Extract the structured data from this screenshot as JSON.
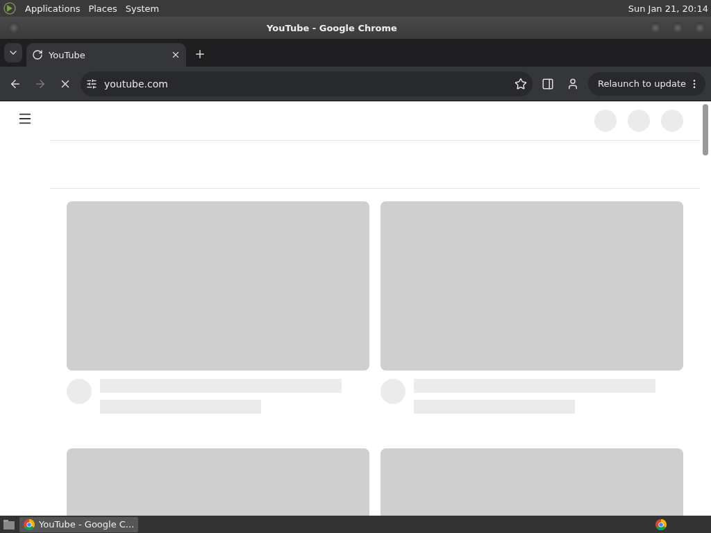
{
  "top_panel": {
    "menus": [
      "Applications",
      "Places",
      "System"
    ],
    "clock": "Sun Jan 21, 20:14"
  },
  "window": {
    "title": "YouTube - Google Chrome"
  },
  "tabs": [
    {
      "label": "YouTube",
      "selected": true
    }
  ],
  "toolbar": {
    "address": "youtube.com",
    "loading": true,
    "relaunch": "Relaunch to update"
  },
  "taskbar": {
    "items": [
      {
        "label": "YouTube - Google C...",
        "selected": true
      }
    ]
  }
}
